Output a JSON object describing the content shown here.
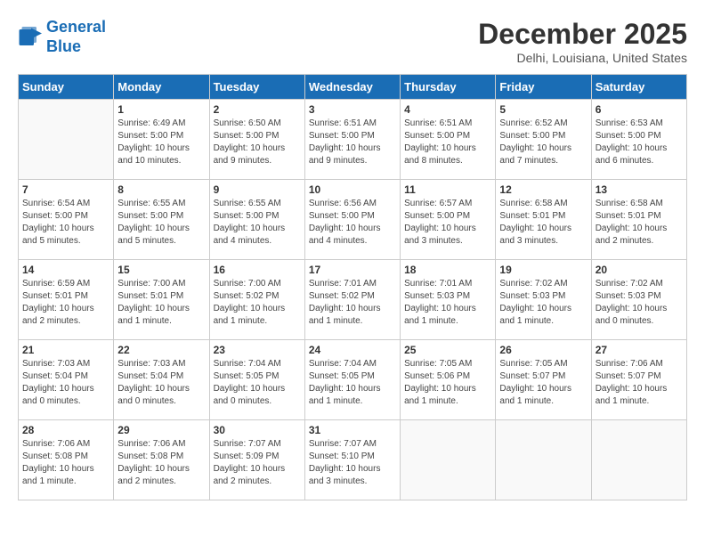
{
  "header": {
    "logo_line1": "General",
    "logo_line2": "Blue",
    "month": "December 2025",
    "location": "Delhi, Louisiana, United States"
  },
  "weekdays": [
    "Sunday",
    "Monday",
    "Tuesday",
    "Wednesday",
    "Thursday",
    "Friday",
    "Saturday"
  ],
  "weeks": [
    [
      {
        "day": "",
        "info": ""
      },
      {
        "day": "1",
        "info": "Sunrise: 6:49 AM\nSunset: 5:00 PM\nDaylight: 10 hours\nand 10 minutes."
      },
      {
        "day": "2",
        "info": "Sunrise: 6:50 AM\nSunset: 5:00 PM\nDaylight: 10 hours\nand 9 minutes."
      },
      {
        "day": "3",
        "info": "Sunrise: 6:51 AM\nSunset: 5:00 PM\nDaylight: 10 hours\nand 9 minutes."
      },
      {
        "day": "4",
        "info": "Sunrise: 6:51 AM\nSunset: 5:00 PM\nDaylight: 10 hours\nand 8 minutes."
      },
      {
        "day": "5",
        "info": "Sunrise: 6:52 AM\nSunset: 5:00 PM\nDaylight: 10 hours\nand 7 minutes."
      },
      {
        "day": "6",
        "info": "Sunrise: 6:53 AM\nSunset: 5:00 PM\nDaylight: 10 hours\nand 6 minutes."
      }
    ],
    [
      {
        "day": "7",
        "info": "Sunrise: 6:54 AM\nSunset: 5:00 PM\nDaylight: 10 hours\nand 5 minutes."
      },
      {
        "day": "8",
        "info": "Sunrise: 6:55 AM\nSunset: 5:00 PM\nDaylight: 10 hours\nand 5 minutes."
      },
      {
        "day": "9",
        "info": "Sunrise: 6:55 AM\nSunset: 5:00 PM\nDaylight: 10 hours\nand 4 minutes."
      },
      {
        "day": "10",
        "info": "Sunrise: 6:56 AM\nSunset: 5:00 PM\nDaylight: 10 hours\nand 4 minutes."
      },
      {
        "day": "11",
        "info": "Sunrise: 6:57 AM\nSunset: 5:00 PM\nDaylight: 10 hours\nand 3 minutes."
      },
      {
        "day": "12",
        "info": "Sunrise: 6:58 AM\nSunset: 5:01 PM\nDaylight: 10 hours\nand 3 minutes."
      },
      {
        "day": "13",
        "info": "Sunrise: 6:58 AM\nSunset: 5:01 PM\nDaylight: 10 hours\nand 2 minutes."
      }
    ],
    [
      {
        "day": "14",
        "info": "Sunrise: 6:59 AM\nSunset: 5:01 PM\nDaylight: 10 hours\nand 2 minutes."
      },
      {
        "day": "15",
        "info": "Sunrise: 7:00 AM\nSunset: 5:01 PM\nDaylight: 10 hours\nand 1 minute."
      },
      {
        "day": "16",
        "info": "Sunrise: 7:00 AM\nSunset: 5:02 PM\nDaylight: 10 hours\nand 1 minute."
      },
      {
        "day": "17",
        "info": "Sunrise: 7:01 AM\nSunset: 5:02 PM\nDaylight: 10 hours\nand 1 minute."
      },
      {
        "day": "18",
        "info": "Sunrise: 7:01 AM\nSunset: 5:03 PM\nDaylight: 10 hours\nand 1 minute."
      },
      {
        "day": "19",
        "info": "Sunrise: 7:02 AM\nSunset: 5:03 PM\nDaylight: 10 hours\nand 1 minute."
      },
      {
        "day": "20",
        "info": "Sunrise: 7:02 AM\nSunset: 5:03 PM\nDaylight: 10 hours\nand 0 minutes."
      }
    ],
    [
      {
        "day": "21",
        "info": "Sunrise: 7:03 AM\nSunset: 5:04 PM\nDaylight: 10 hours\nand 0 minutes."
      },
      {
        "day": "22",
        "info": "Sunrise: 7:03 AM\nSunset: 5:04 PM\nDaylight: 10 hours\nand 0 minutes."
      },
      {
        "day": "23",
        "info": "Sunrise: 7:04 AM\nSunset: 5:05 PM\nDaylight: 10 hours\nand 0 minutes."
      },
      {
        "day": "24",
        "info": "Sunrise: 7:04 AM\nSunset: 5:05 PM\nDaylight: 10 hours\nand 1 minute."
      },
      {
        "day": "25",
        "info": "Sunrise: 7:05 AM\nSunset: 5:06 PM\nDaylight: 10 hours\nand 1 minute."
      },
      {
        "day": "26",
        "info": "Sunrise: 7:05 AM\nSunset: 5:07 PM\nDaylight: 10 hours\nand 1 minute."
      },
      {
        "day": "27",
        "info": "Sunrise: 7:06 AM\nSunset: 5:07 PM\nDaylight: 10 hours\nand 1 minute."
      }
    ],
    [
      {
        "day": "28",
        "info": "Sunrise: 7:06 AM\nSunset: 5:08 PM\nDaylight: 10 hours\nand 1 minute."
      },
      {
        "day": "29",
        "info": "Sunrise: 7:06 AM\nSunset: 5:08 PM\nDaylight: 10 hours\nand 2 minutes."
      },
      {
        "day": "30",
        "info": "Sunrise: 7:07 AM\nSunset: 5:09 PM\nDaylight: 10 hours\nand 2 minutes."
      },
      {
        "day": "31",
        "info": "Sunrise: 7:07 AM\nSunset: 5:10 PM\nDaylight: 10 hours\nand 3 minutes."
      },
      {
        "day": "",
        "info": ""
      },
      {
        "day": "",
        "info": ""
      },
      {
        "day": "",
        "info": ""
      }
    ]
  ]
}
